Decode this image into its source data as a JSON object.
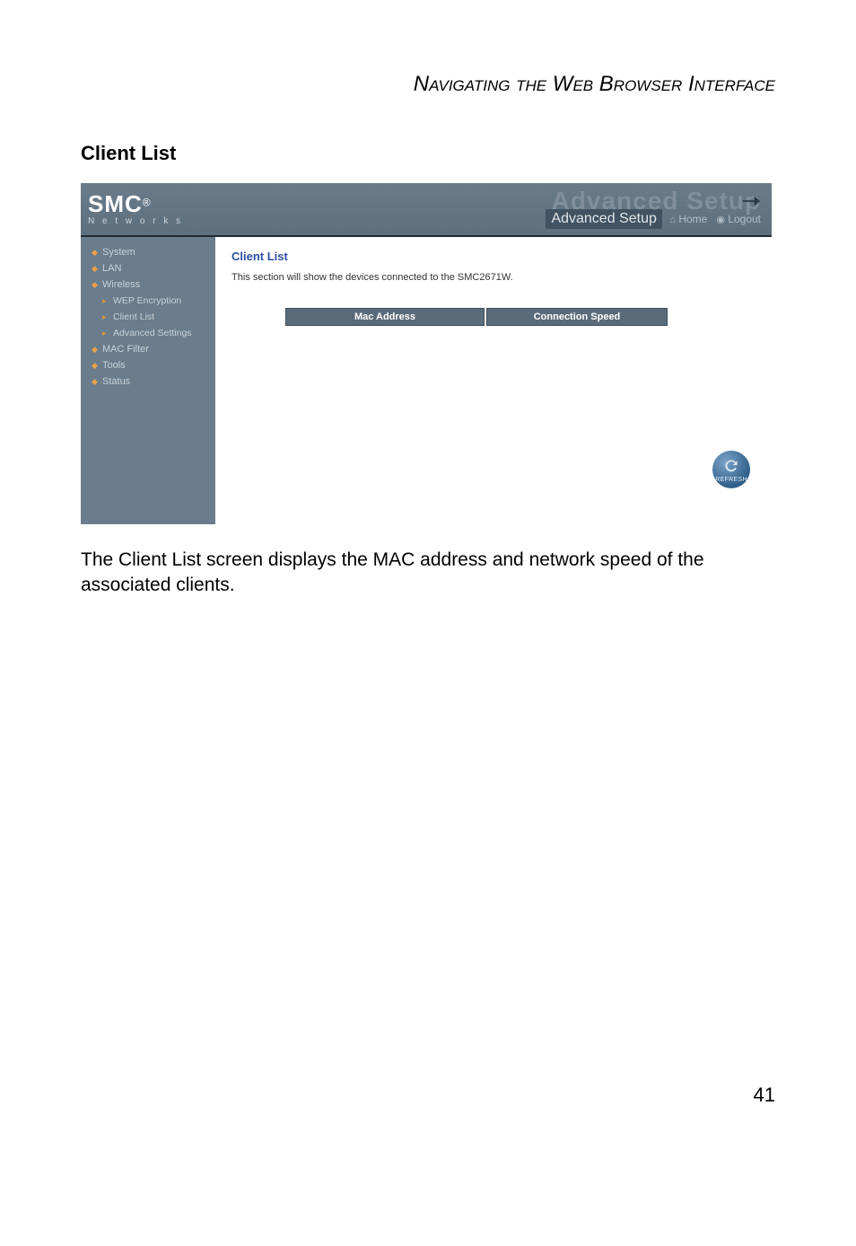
{
  "running_head": "Navigating the Web Browser Interface",
  "section_title": "Client List",
  "screenshot": {
    "brand": {
      "name": "SMC",
      "reg": "®",
      "sub": "N e t w o r k s"
    },
    "header": {
      "ghost": "Advanced Setup",
      "box": "Advanced Setup",
      "home": "Home",
      "logout": "Logout"
    },
    "sidebar": {
      "items": [
        {
          "label": "System",
          "sub": false
        },
        {
          "label": "LAN",
          "sub": false
        },
        {
          "label": "Wireless",
          "sub": false
        },
        {
          "label": "WEP Encryption",
          "sub": true
        },
        {
          "label": "Client List",
          "sub": true
        },
        {
          "label": "Advanced Settings",
          "sub": true
        },
        {
          "label": "MAC Filter",
          "sub": false
        },
        {
          "label": "Tools",
          "sub": false
        },
        {
          "label": "Status",
          "sub": false
        }
      ]
    },
    "content": {
      "title": "Client List",
      "desc": "This section will show the devices connected to the SMC2671W.",
      "col_mac": "Mac Address",
      "col_speed": "Connection Speed",
      "refresh": "REFRESH"
    }
  },
  "body_text": "The Client List screen displays the MAC address and network speed of the associated clients.",
  "page_number": "41"
}
